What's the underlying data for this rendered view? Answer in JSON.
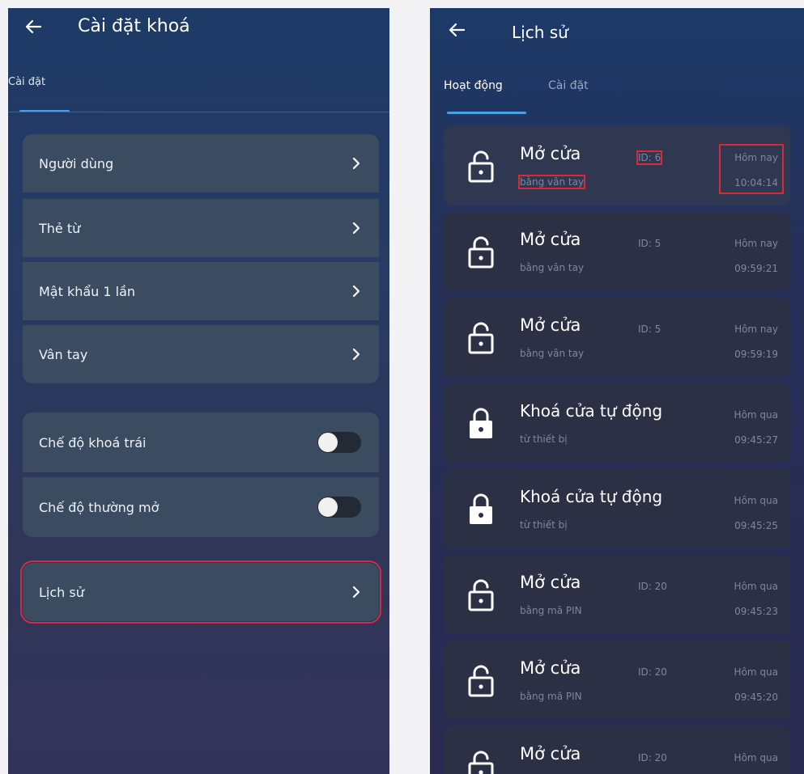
{
  "settings_screen": {
    "title": "Cài đặt khoá",
    "tab": "Cài đặt",
    "group1": [
      "Người dùng",
      "Thẻ từ",
      "Mật khẩu 1 lần",
      "Vân tay"
    ],
    "group2": [
      "Chế độ khoá trái",
      "Chế độ thường mở"
    ],
    "history": "Lịch sử"
  },
  "history_screen": {
    "title": "Lịch sử",
    "tabs": [
      "Hoạt động",
      "Cài đặt"
    ],
    "events": [
      {
        "title": "Mở cửa",
        "sub": "bằng vân tay",
        "id": "ID: 6",
        "day": "Hôm nay",
        "time": "10:04:14",
        "lock_state": "unlocked"
      },
      {
        "title": "Mở cửa",
        "sub": "bằng vân tay",
        "id": "ID: 5",
        "day": "Hôm nay",
        "time": "09:59:21",
        "lock_state": "unlocked"
      },
      {
        "title": "Mở cửa",
        "sub": "bằng vân tay",
        "id": "ID: 5",
        "day": "Hôm nay",
        "time": "09:59:19",
        "lock_state": "unlocked"
      },
      {
        "title": "Khoá cửa tự động",
        "sub": "từ thiết bị",
        "id": "",
        "day": "Hôm qua",
        "time": "09:45:27",
        "lock_state": "locked"
      },
      {
        "title": "Khoá cửa tự động",
        "sub": "từ thiết bị",
        "id": "",
        "day": "Hôm qua",
        "time": "09:45:25",
        "lock_state": "locked"
      },
      {
        "title": "Mở cửa",
        "sub": "bằng mã PIN",
        "id": "ID: 20",
        "day": "Hôm qua",
        "time": "09:45:23",
        "lock_state": "unlocked"
      },
      {
        "title": "Mở cửa",
        "sub": "bằng mã PIN",
        "id": "ID: 20",
        "day": "Hôm qua",
        "time": "09:45:20",
        "lock_state": "unlocked"
      },
      {
        "title": "Mở cửa",
        "sub": "",
        "id": "ID: 20",
        "day": "Hôm qua",
        "time": "",
        "lock_state": "unlocked"
      }
    ]
  },
  "colors": {
    "highlight": "#d62a3c",
    "accent": "#4a9fe8",
    "card": "#2c3045"
  }
}
